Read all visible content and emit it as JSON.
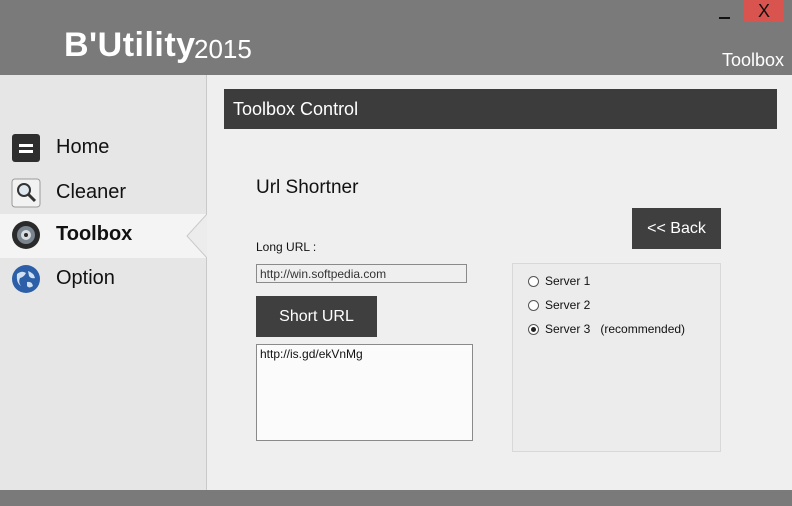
{
  "header": {
    "app_name": "B'Utility",
    "app_year": "2015",
    "section": "Toolbox",
    "close_label": "X"
  },
  "sidebar": {
    "items": [
      {
        "label": "Home",
        "icon": "home-icon",
        "active": false
      },
      {
        "label": "Cleaner",
        "icon": "magnifier-icon",
        "active": false
      },
      {
        "label": "Toolbox",
        "icon": "toolbox-icon",
        "active": true
      },
      {
        "label": "Option",
        "icon": "globe-icon",
        "active": false
      }
    ]
  },
  "main": {
    "panel_title": "Toolbox Control",
    "sub_title": "Url Shortner",
    "back_label": "<< Back",
    "long_url_label": "Long URL :",
    "long_url_value": "http://win.softpedia.com",
    "short_button_label": "Short URL",
    "result_value": "http://is.gd/ekVnMg",
    "servers": [
      {
        "label": "Server 1",
        "note": "",
        "selected": false
      },
      {
        "label": "Server 2",
        "note": "",
        "selected": false
      },
      {
        "label": "Server 3",
        "note": "(recommended)",
        "selected": true
      }
    ]
  },
  "colors": {
    "topbar": "#7a7a7a",
    "dark_button": "#3f3f3f",
    "close_button": "#d9534f"
  }
}
